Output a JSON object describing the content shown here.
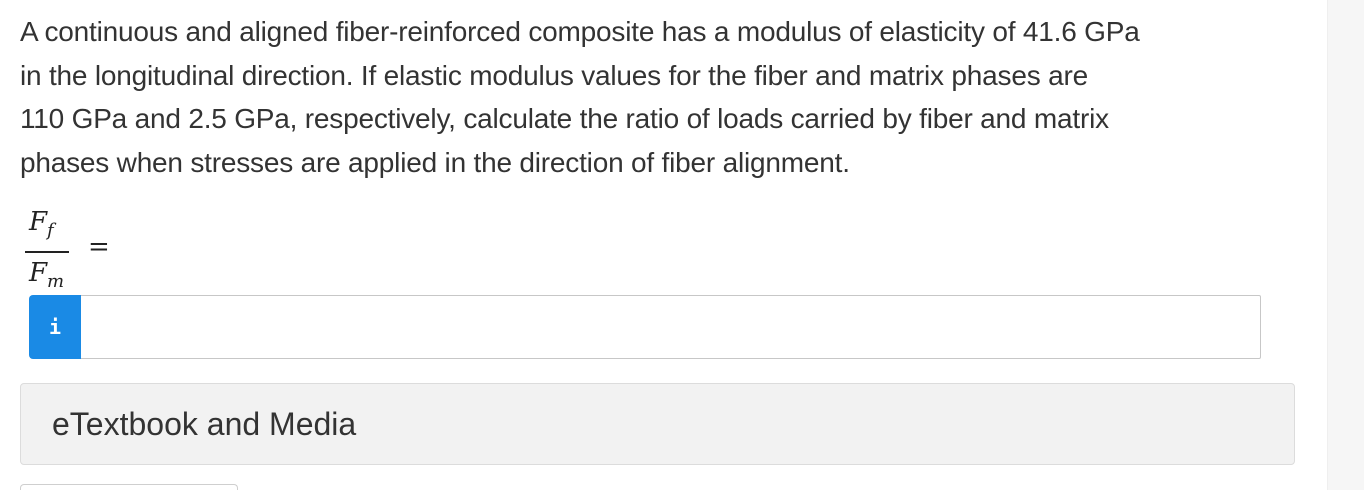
{
  "question": {
    "lines": [
      "A continuous and aligned fiber-reinforced composite has a modulus of elasticity of 41.6 GPa",
      "in the longitudinal direction.  If elastic modulus values for the fiber and matrix phases are",
      "110 GPa and 2.5 GPa, respectively, calculate the ratio of loads carried by fiber and matrix",
      "phases when stresses are applied in the direction of fiber alignment."
    ]
  },
  "formula": {
    "numerator": "F",
    "numerator_sub": "f",
    "denominator": "F",
    "denominator_sub": "m",
    "equals": "="
  },
  "answer": {
    "info_icon": "i",
    "value": "",
    "placeholder": ""
  },
  "resources": {
    "etextbook_label": "eTextbook and Media"
  },
  "colors": {
    "info_button": "#1a8ae5",
    "panel_background": "#f2f2f2",
    "text": "#333333"
  }
}
